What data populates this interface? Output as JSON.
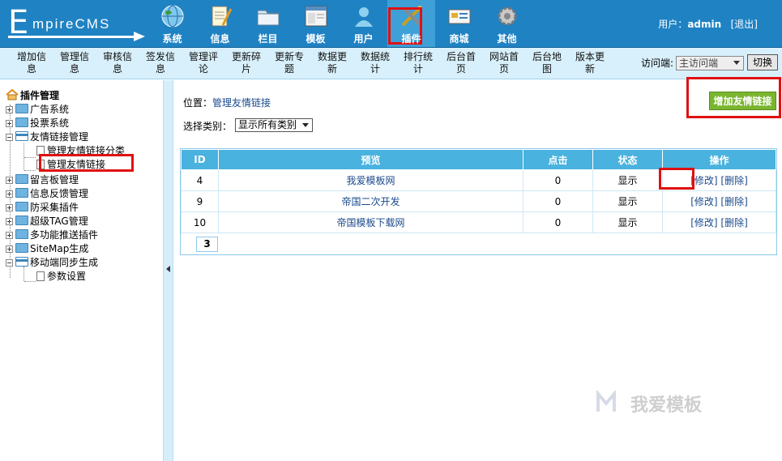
{
  "header": {
    "logo_e": "E",
    "logo_rest": "mpireCMS",
    "nav": [
      {
        "label": "系统",
        "icon": "globe-icon"
      },
      {
        "label": "信息",
        "icon": "notepad-icon"
      },
      {
        "label": "栏目",
        "icon": "folder-icon"
      },
      {
        "label": "模板",
        "icon": "window-icon"
      },
      {
        "label": "用户",
        "icon": "user-icon"
      },
      {
        "label": "插件",
        "icon": "tools-icon",
        "active": true
      },
      {
        "label": "商城",
        "icon": "card-icon"
      },
      {
        "label": "其他",
        "icon": "gear-icon"
      }
    ],
    "user_prefix": "用户：",
    "username": "admin",
    "logout": "[退出]"
  },
  "subnav": {
    "items": [
      "增加信息",
      "管理信息",
      "审核信息",
      "签发信息",
      "管理评论",
      "更新碎片",
      "更新专题",
      "数据更新",
      "数据统计",
      "排行统计",
      "后台首页",
      "网站首页",
      "后台地图",
      "版本更新"
    ],
    "access_label": "访问端:",
    "access_value": "主访问端",
    "switch_label": "切换"
  },
  "sidebar": {
    "title": "插件管理",
    "nodes": [
      {
        "label": "广告系统",
        "state": "collapsed"
      },
      {
        "label": "投票系统",
        "state": "collapsed"
      },
      {
        "label": "友情链接管理",
        "state": "expanded"
      },
      {
        "label": "管理友情链接分类",
        "state": "leaf"
      },
      {
        "label": "管理友情链接",
        "state": "leaf"
      },
      {
        "label": "留言板管理",
        "state": "collapsed"
      },
      {
        "label": "信息反馈管理",
        "state": "collapsed"
      },
      {
        "label": "防采集插件",
        "state": "collapsed"
      },
      {
        "label": "超级TAG管理",
        "state": "collapsed"
      },
      {
        "label": "多功能推送插件",
        "state": "collapsed"
      },
      {
        "label": "SiteMap生成",
        "state": "collapsed"
      },
      {
        "label": "移动端同步生成",
        "state": "expanded"
      },
      {
        "label": "参数设置",
        "state": "leaf"
      }
    ]
  },
  "main": {
    "location_label": "位置：",
    "location_link": "管理友情链接",
    "category_label": "选择类别：",
    "category_value": "显示所有类别",
    "add_button": "增加友情链接",
    "table": {
      "headers": [
        "ID",
        "预览",
        "点击",
        "状态",
        "操作"
      ],
      "rows": [
        {
          "id": "4",
          "name": "我爱模板网",
          "clicks": "0",
          "status": "显示",
          "edit": "[修改]",
          "del": "[删除]"
        },
        {
          "id": "9",
          "name": "帝国二次开发",
          "clicks": "0",
          "status": "显示",
          "edit": "[修改]",
          "del": "[删除]"
        },
        {
          "id": "10",
          "name": "帝国模板下载网",
          "clicks": "0",
          "status": "显示",
          "edit": "[修改]",
          "del": "[删除]"
        }
      ]
    },
    "page_number": "3"
  },
  "watermark": "我爱模板",
  "colors": {
    "header_bg": "#1f82c3",
    "subnav_bg": "#d8f0fb",
    "table_header": "#49b2df",
    "add_button": "#7ab530",
    "highlight_box": "#e01010"
  }
}
